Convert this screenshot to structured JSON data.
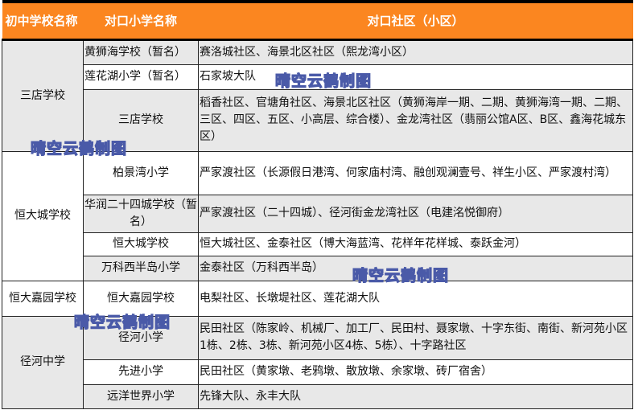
{
  "header": {
    "col1": "初中学校名称",
    "col2": "对口小学名称",
    "col3": "对口社区（小区）"
  },
  "groups": [
    {
      "middle": "三店学校",
      "rows": [
        {
          "primary": "黄狮海学校（暂名）",
          "community": "赛洛城社区、海景北区社区（熙龙湾小区）"
        },
        {
          "primary": "莲花湖小学（暂名）",
          "community": "石家坡大队"
        },
        {
          "primary": "三店学校",
          "community": "稻香社区、官塘角社区、海景北区社区（黄狮海岸一期、二期、黄狮海湾一期、二期、三区、四区、五区、小高层、综合楼）、金龙湾社区（翡丽公馆A区、B区、鑫海花城东区）"
        }
      ]
    },
    {
      "middle": "恒大城学校",
      "rows": [
        {
          "primary": "柏景湾小学",
          "community": "严家渡社区（长源假日港湾、何家庙村湾、融创观澜壹号、祥生小区、严家渡村湾）"
        },
        {
          "primary": "华润二十四城学校（暂名）",
          "community": "严家渡社区（二十四城）、径河街金龙湾社区（电建洺悦御府）"
        },
        {
          "primary": "恒大城学校",
          "community": "恒大城社区、金泰社区（博大海蓝湾、花样年花样城、泰跃金河）"
        },
        {
          "primary": "万科西半岛小学",
          "community": "金泰社区（万科西半岛）"
        }
      ]
    },
    {
      "middle": "恒大嘉园学校",
      "rows": [
        {
          "primary": "恒大嘉园学校",
          "community": "电梨社区、长墩堤社区、莲花湖大队"
        }
      ]
    },
    {
      "middle": "径河中学",
      "rows": [
        {
          "primary": "径河小学",
          "community": "民田社区（陈家岭、机械厂、加工厂、民田村、聂家墩、十字东街、南街、新河苑小区1栋、2栋、3栋、新河苑小区4栋、5栋）、十字路社区"
        },
        {
          "primary": "先进小学",
          "community": "民田社区（黄家墩、老鸦墩、散放墩、余家墩、砖厂宿舍）"
        },
        {
          "primary": "远洋世界小学",
          "community": "先锋大队、永丰大队"
        }
      ]
    }
  ],
  "watermark": "晴空云鹤制图",
  "colors": {
    "header": "#fb8620",
    "row_alt": "#e8e8e8"
  }
}
